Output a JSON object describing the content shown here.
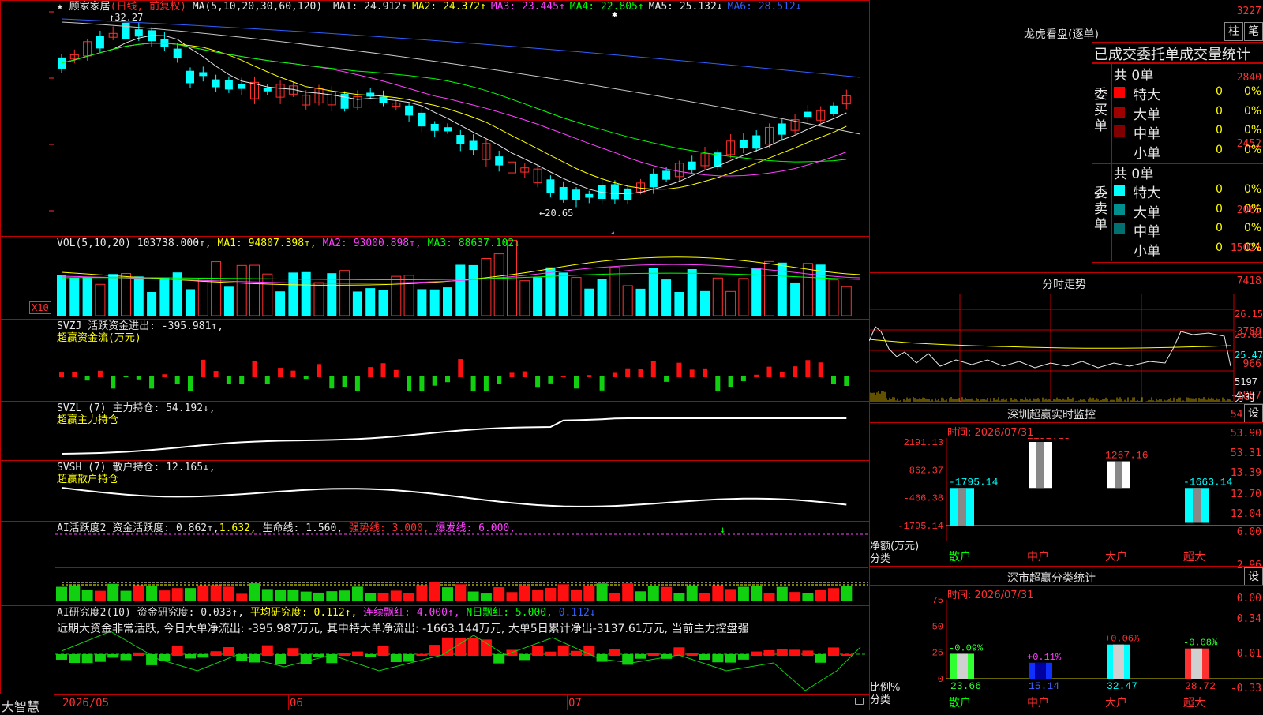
{
  "stock": {
    "name": "顾家家居",
    "mode": "(日线, 前复权)",
    "ma_label": "MA(5,10,20,30,60,120)",
    "ma": [
      {
        "label": "MA1:",
        "value": "24.912",
        "arrow": "↑",
        "color": "#e8e8e8"
      },
      {
        "label": "MA2:",
        "value": "24.372",
        "arrow": "↑",
        "color": "#ffff00"
      },
      {
        "label": "MA3:",
        "value": "23.445",
        "arrow": "↑",
        "color": "#ff40ff"
      },
      {
        "label": "MA4:",
        "value": "22.805",
        "arrow": "↑",
        "color": "#00ff00"
      },
      {
        "label": "MA5:",
        "value": "25.132",
        "arrow": "↓",
        "color": "#e8e8e8"
      },
      {
        "label": "MA6:",
        "value": "28.512",
        "arrow": "↓",
        "color": "#3060ff"
      }
    ],
    "high_label": "32.27",
    "low_label": "←20.65",
    "y_labels": [
      "3227",
      "2840",
      "2452",
      "2065"
    ]
  },
  "vol": {
    "legend": "VOL(5,10,20)",
    "value": "103738.000↑,",
    "ma1": "MA1: 94807.398↑,",
    "ma2": "MA2: 93000.898↑,",
    "ma3": "MA3: 88637.102↓",
    "y_labels": [
      "15021",
      "7418"
    ],
    "unit": "X10"
  },
  "svzj": {
    "legend": "SVZJ  活跃资金进出: -395.981↑,",
    "sub": "超赢资金流(万元)",
    "y_labels": [
      "3789",
      "966",
      "-1857"
    ]
  },
  "svzl": {
    "legend": "SVZL (7) 主力持仓: 54.192↓,",
    "sub": "超赢主力持仓",
    "y_labels": [
      "54.50",
      "53.90",
      "53.31"
    ]
  },
  "svsh": {
    "legend": "SVSH (7) 散户持仓: 12.165↓,",
    "sub": "超赢散户持仓",
    "y_labels": [
      "13.39",
      "12.70",
      "12.04"
    ]
  },
  "ai1": {
    "legend_a": "AI活跃度2 资金活跃度: 0.862↑,",
    "legend_b": "1.632,",
    "legend_c": "生命线: 1.560,",
    "legend_d": "强势线: 3.000,",
    "legend_e": "爆发线: 6.000,",
    "y_labels": [
      "6.00",
      "2.96",
      "0.00"
    ]
  },
  "ai2": {
    "legend_a": "AI研究度2(10) 资金研究度: 0.033↑,",
    "legend_b": "平均研究度: 0.112↑,",
    "legend_c": "连续飘红: 4.000↑,",
    "legend_d": "N日飘红: 5.000,",
    "legend_e": "0.112↓",
    "comment": "近期大资金非常活跃, 今日大单净流出: -395.987万元, 其中特大单净流出: -1663.144万元, 大单5日累计净出-3137.61万元, 当前主力控盘强",
    "y_labels": [
      "0.34",
      "0.01",
      "-0.33"
    ]
  },
  "footer": {
    "brand": "大智慧",
    "dates": [
      "2026/05",
      "06",
      "07"
    ]
  },
  "longhu": {
    "title": "龙虎看盘(逐单)",
    "btn1": "柱",
    "btn2": "笔",
    "header": "已成交委托单成交量统计",
    "buy_total": "共 0单",
    "sell_total": "共 0单",
    "buy_label": "委买单",
    "sell_label": "委卖单",
    "buy_rows": [
      {
        "name": "特大",
        "count": "0",
        "pct": "0%",
        "color": "#ff0000"
      },
      {
        "name": "大单",
        "count": "0",
        "pct": "0%",
        "color": "#a00000"
      },
      {
        "name": "中单",
        "count": "0",
        "pct": "0%",
        "color": "#800000"
      },
      {
        "name": "小单",
        "count": "0",
        "pct": "0%",
        "color": "#000000"
      }
    ],
    "sell_rows": [
      {
        "name": "特大",
        "count": "0",
        "pct": "0%",
        "color": "#00ffff"
      },
      {
        "name": "大单",
        "count": "0",
        "pct": "0%",
        "color": "#009090"
      },
      {
        "name": "中单",
        "count": "0",
        "pct": "0%",
        "color": "#007070"
      },
      {
        "name": "小单",
        "count": "0",
        "pct": "0%",
        "color": "#000000"
      }
    ]
  },
  "fenshi": {
    "title": "分时走势",
    "labels": [
      "26.15",
      "25.81",
      "25.47"
    ],
    "vol_label": "5197",
    "unit": "分时"
  },
  "monitor": {
    "title": "深圳超赢实时监控",
    "btn": "设",
    "time": "时间: 2026/07/31",
    "y_labels": [
      "2191.13",
      "862.37",
      "-466.38",
      "-1795.14"
    ],
    "axis_label_a": "净额(万元)",
    "axis_label_b": "分类",
    "chart_data": {
      "type": "bar",
      "categories": [
        "散户",
        "中户",
        "大户",
        "超大"
      ],
      "values": [
        -1795.14,
        2191.13,
        1267.16,
        -1663.14
      ],
      "labels": [
        "-1795.14",
        "2191.13",
        "1267.16",
        "-1663.14"
      ],
      "ylim": [
        -1795.14,
        2191.13
      ]
    }
  },
  "stats": {
    "title": "深市超赢分类统计",
    "btn": "设",
    "time": "时间: 2026/07/31",
    "y_labels": [
      "75",
      "50",
      "25",
      "0"
    ],
    "axis_label_a": "比例%",
    "axis_label_b": "分类",
    "chart_data": {
      "type": "bar",
      "categories": [
        "散户",
        "中户",
        "大户",
        "超大"
      ],
      "values": [
        23.66,
        15.14,
        32.47,
        28.72
      ],
      "changes": [
        "-0.09%",
        "+0.11%",
        "+0.06%",
        "-0.08%"
      ],
      "value_labels": [
        "23.66",
        "15.14",
        "32.47",
        "28.72"
      ],
      "ylim": [
        0,
        75
      ]
    }
  },
  "colors": {
    "up": "#ff3030",
    "down": "#00ffff",
    "border": "#c00000"
  }
}
